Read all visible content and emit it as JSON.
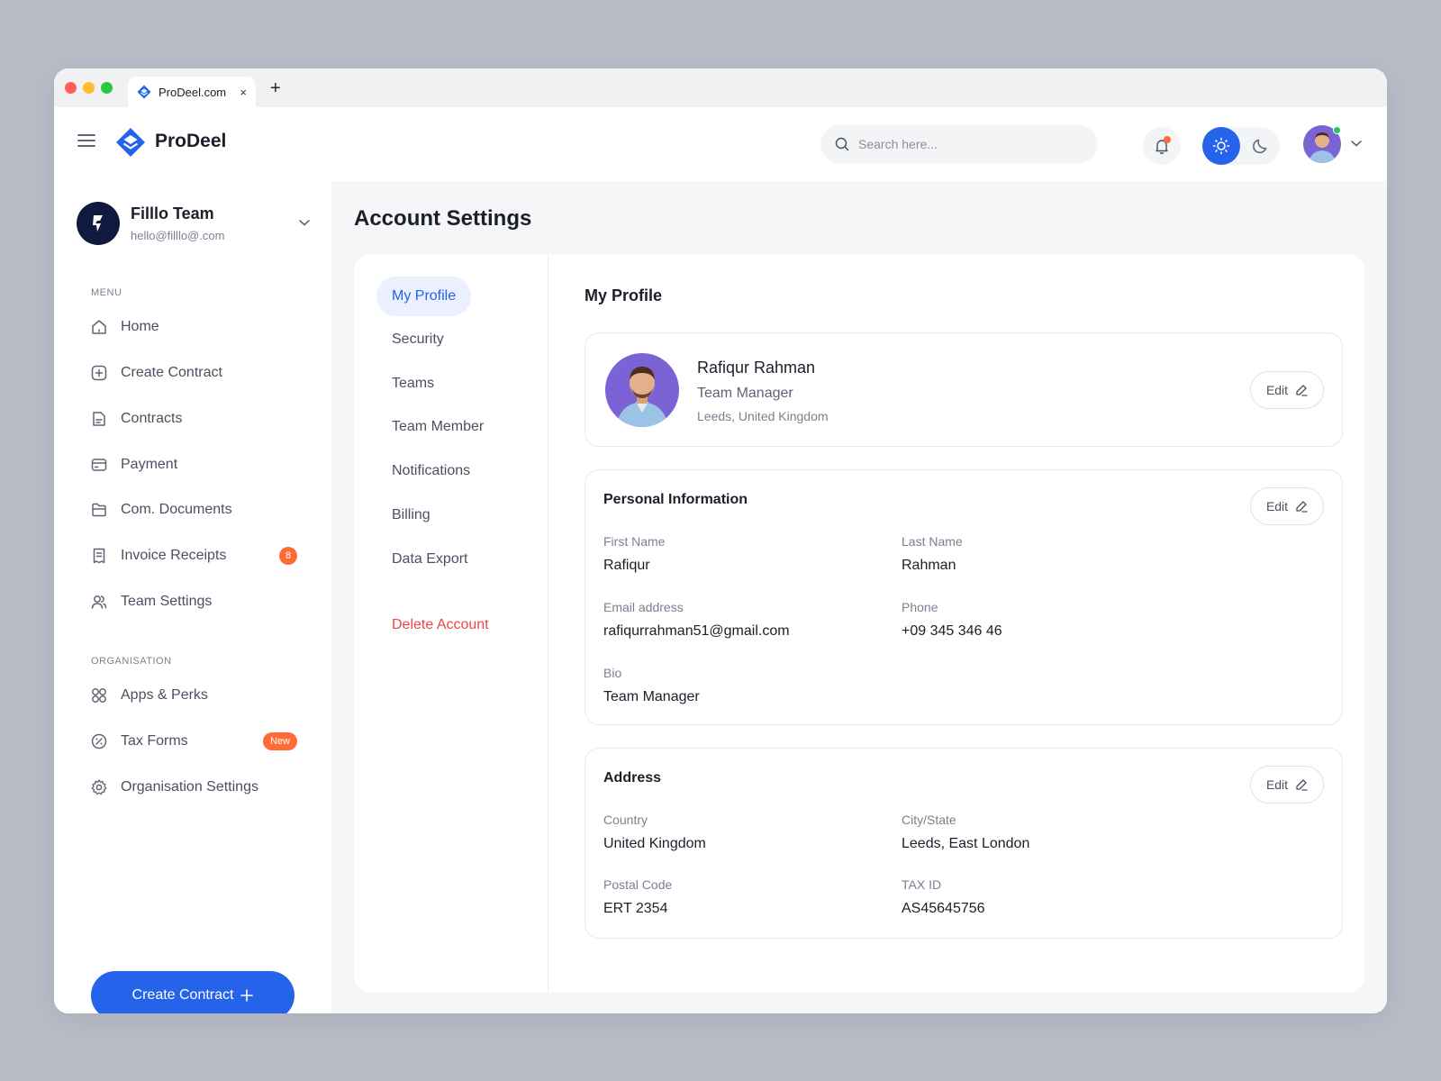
{
  "browser": {
    "tab_title": "ProDeel.com",
    "tab_close": "×",
    "new_tab": "+"
  },
  "header": {
    "brand": "ProDeel",
    "search_placeholder": "Search here..."
  },
  "team": {
    "name": "Filllo Team",
    "email": "hello@filllo@.com"
  },
  "sidebar": {
    "menu_label": "MENU",
    "menu_items": [
      {
        "label": "Home",
        "icon": "home-icon"
      },
      {
        "label": "Create Contract",
        "icon": "plus-square-icon"
      },
      {
        "label": "Contracts",
        "icon": "document-icon"
      },
      {
        "label": "Payment",
        "icon": "card-icon"
      },
      {
        "label": "Com. Documents",
        "icon": "folder-icon"
      },
      {
        "label": "Invoice Receipts",
        "icon": "receipt-icon",
        "badge": "8"
      },
      {
        "label": "Team Settings",
        "icon": "users-icon"
      }
    ],
    "org_label": "ORGANISATION",
    "org_items": [
      {
        "label": "Apps & Perks",
        "icon": "grid-icon"
      },
      {
        "label": "Tax Forms",
        "icon": "percent-icon",
        "badge": "New"
      },
      {
        "label": "Organisation Settings",
        "icon": "gear-icon"
      }
    ],
    "create_button": "Create Contract"
  },
  "main": {
    "page_title": "Account Settings",
    "settings_nav": [
      {
        "label": "My Profile",
        "active": true
      },
      {
        "label": "Security"
      },
      {
        "label": "Teams"
      },
      {
        "label": "Team Member"
      },
      {
        "label": "Notifications"
      },
      {
        "label": "Billing"
      },
      {
        "label": "Data Export"
      }
    ],
    "delete_account": "Delete Account",
    "content_title": "My Profile",
    "edit_label": "Edit",
    "profile": {
      "name": "Rafiqur Rahman",
      "role": "Team Manager",
      "location": "Leeds, United Kingdom"
    },
    "personal": {
      "title": "Personal Information",
      "first_name_label": "First Name",
      "first_name": "Rafiqur",
      "last_name_label": "Last Name",
      "last_name": "Rahman",
      "email_label": "Email address",
      "email": "rafiqurrahman51@gmail.com",
      "phone_label": "Phone",
      "phone": "+09 345 346 46",
      "bio_label": "Bio",
      "bio": "Team Manager"
    },
    "address": {
      "title": "Address",
      "country_label": "Country",
      "country": "United Kingdom",
      "city_label": "City/State",
      "city": "Leeds, East London",
      "postal_label": "Postal Code",
      "postal": "ERT 2354",
      "tax_label": "TAX ID",
      "tax": "AS45645756"
    }
  },
  "colors": {
    "accent": "#2563eb",
    "badge": "#ff6b35",
    "danger": "#ef4444",
    "online": "#22c55e"
  }
}
